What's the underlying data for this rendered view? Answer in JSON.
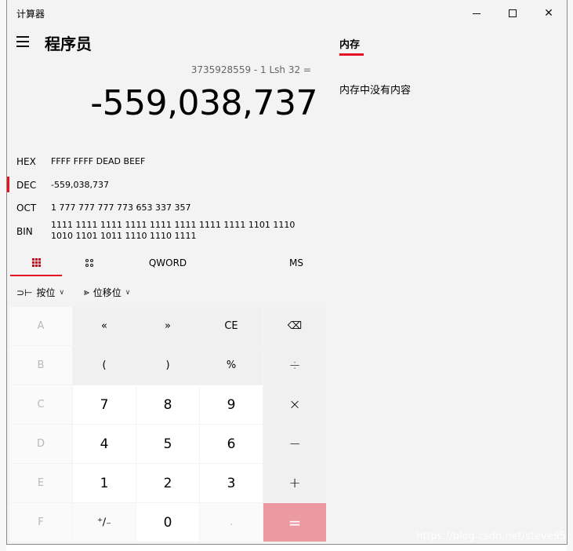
{
  "window": {
    "title": "计算器",
    "controls": {
      "minimize": "minimize-icon",
      "maximize": "maximize-icon",
      "close": "close-icon"
    }
  },
  "header": {
    "menu_icon": "hamburger-icon",
    "mode": "程序员"
  },
  "display": {
    "expression": "3735928559 - 1 Lsh 32 =",
    "result": "-559,038,737"
  },
  "radix": [
    {
      "name": "HEX",
      "value": "FFFF FFFF DEAD BEEF",
      "active": false
    },
    {
      "name": "DEC",
      "value": "-559,038,737",
      "active": true
    },
    {
      "name": "OCT",
      "value": "1 777 777 777 773 653 337 357",
      "active": false
    },
    {
      "name": "BIN",
      "value": "1111 1111 1111 1111 1111 1111 1111 1111 1101 1110 1010 1101 1011 1110 1110 1111",
      "active": false
    }
  ],
  "keyboard_tabs": {
    "full_keypad_icon": "full-keypad-icon",
    "bit_toggle_icon": "bit-toggle-icon",
    "word_size": "QWORD",
    "memory_store": "MS"
  },
  "operators": {
    "bitwise": "按位",
    "bitshift": "位移位"
  },
  "keypad": [
    [
      "A",
      "«",
      "»",
      "CE",
      "⌫"
    ],
    [
      "B",
      "(",
      ")",
      "%",
      "÷"
    ],
    [
      "C",
      "7",
      "8",
      "9",
      "×"
    ],
    [
      "D",
      "4",
      "5",
      "6",
      "−"
    ],
    [
      "E",
      "1",
      "2",
      "3",
      "+"
    ],
    [
      "F",
      "⁺∕₋",
      "0",
      ".",
      "="
    ]
  ],
  "memory": {
    "title": "内存",
    "empty_message": "内存中没有内容"
  },
  "watermark": "https://blog.csdn.net/steve95",
  "colors": {
    "accent": "#e81123",
    "equals": "#eb9aa1",
    "background": "#f3f3f3"
  }
}
